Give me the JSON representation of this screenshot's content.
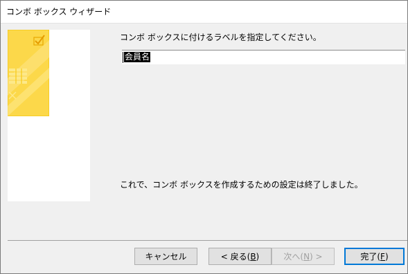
{
  "window": {
    "title": "コンボ ボックス ウィザード"
  },
  "main": {
    "prompt": "コンボ ボックスに付けるラベルを指定してください。",
    "label_value": "会員名",
    "finish_message": "これで、コンボ ボックスを作成するための設定は終了しました。"
  },
  "buttons": {
    "cancel": {
      "label": "キャンセル"
    },
    "back": {
      "label_pre": "< 戻る(",
      "accel": "B",
      "label_post": ")"
    },
    "next": {
      "label_pre": "次へ(",
      "accel": "N",
      "label_post": ") >",
      "enabled": false
    },
    "finish": {
      "label_pre": "完了(",
      "accel": "F",
      "label_post": ")",
      "default": true
    }
  },
  "colors": {
    "image_yellow": "#fcd84a",
    "image_yellow_dark": "#f5c400",
    "image_light": "#fde98a",
    "default_button_border": "#0078d7"
  },
  "icons": {
    "wizard_image": "combo-box-wizard-illustration-icon",
    "checkbox": "check-mark-icon"
  }
}
